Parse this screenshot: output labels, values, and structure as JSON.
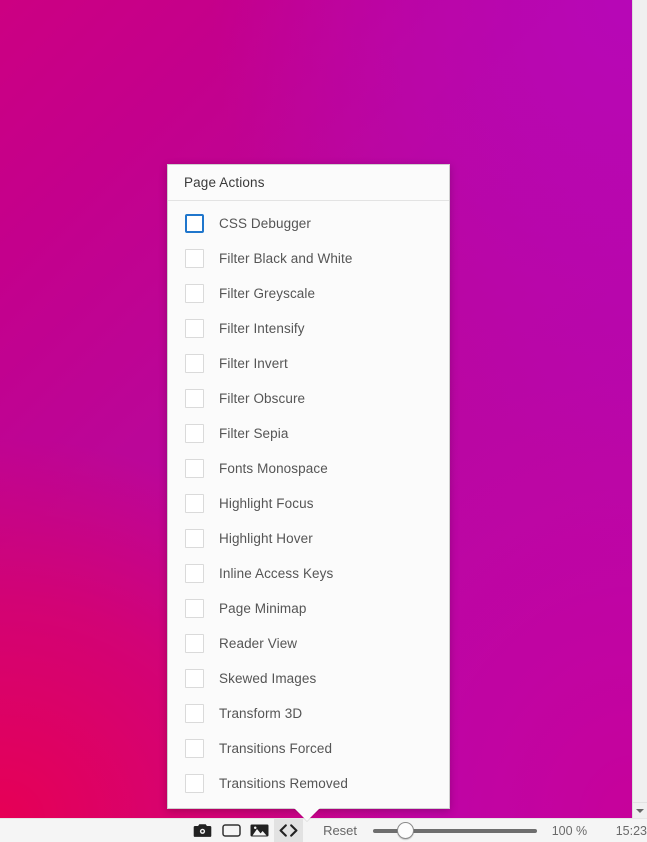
{
  "window": {
    "background_colors": {
      "top_left": "#cc0082",
      "top_right": "#b707b7",
      "bottom_left": "#e60055",
      "bottom_right": "#cc0091"
    }
  },
  "scrollbar": {
    "down_arrow_icon": "triangle-down-icon"
  },
  "popup": {
    "title": "Page Actions",
    "focus_ring_color": "#1f76cc",
    "items": [
      {
        "label": "CSS Debugger",
        "checked": false,
        "focused": true
      },
      {
        "label": "Filter Black and White",
        "checked": false,
        "focused": false
      },
      {
        "label": "Filter Greyscale",
        "checked": false,
        "focused": false
      },
      {
        "label": "Filter Intensify",
        "checked": false,
        "focused": false
      },
      {
        "label": "Filter Invert",
        "checked": false,
        "focused": false
      },
      {
        "label": "Filter Obscure",
        "checked": false,
        "focused": false
      },
      {
        "label": "Filter Sepia",
        "checked": false,
        "focused": false
      },
      {
        "label": "Fonts Monospace",
        "checked": false,
        "focused": false
      },
      {
        "label": "Highlight Focus",
        "checked": false,
        "focused": false
      },
      {
        "label": "Highlight Hover",
        "checked": false,
        "focused": false
      },
      {
        "label": "Inline Access Keys",
        "checked": false,
        "focused": false
      },
      {
        "label": "Page Minimap",
        "checked": false,
        "focused": false
      },
      {
        "label": "Reader View",
        "checked": false,
        "focused": false
      },
      {
        "label": "Skewed Images",
        "checked": false,
        "focused": false
      },
      {
        "label": "Transform 3D",
        "checked": false,
        "focused": false
      },
      {
        "label": "Transitions Forced",
        "checked": false,
        "focused": false
      },
      {
        "label": "Transitions Removed",
        "checked": false,
        "focused": false
      }
    ]
  },
  "toolbar": {
    "buttons": [
      {
        "icon": "camera-icon",
        "active": false
      },
      {
        "icon": "viewport-rectangle-icon",
        "active": false
      },
      {
        "icon": "image-icon",
        "active": false
      },
      {
        "icon": "code-brackets-icon",
        "active": true
      }
    ],
    "reset_label": "Reset",
    "zoom_value": "100 %",
    "slider_position_percent": 16,
    "clock": "15:23"
  }
}
